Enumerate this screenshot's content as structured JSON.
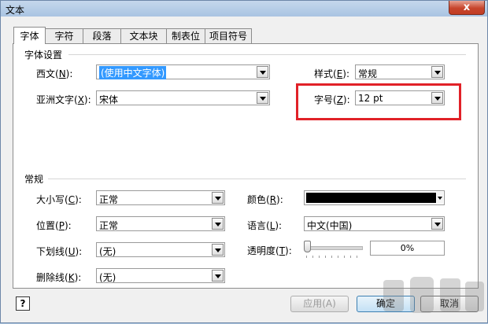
{
  "window": {
    "title": "文本",
    "close_glyph": "x"
  },
  "tabs": [
    "字体",
    "字符",
    "段落",
    "文本块",
    "制表位",
    "项目符号"
  ],
  "font_settings": {
    "group_title": "字体设置",
    "western_label": "西文(",
    "western_key": "N",
    "western_tail": "):",
    "western_value": "(使用中文字体)",
    "asian_label": "亚洲文字(",
    "asian_key": "X",
    "asian_tail": "):",
    "asian_value": "宋体",
    "style_label": "样式(",
    "style_key": "E",
    "style_tail": "):",
    "style_value": "常规",
    "size_label": "字号(",
    "size_key": "Z",
    "size_tail": "):",
    "size_value": "12 pt"
  },
  "general": {
    "group_title": "常规",
    "case_label": "大小写(",
    "case_key": "C",
    "case_tail": "):",
    "case_value": "正常",
    "position_label": "位置(",
    "position_key": "P",
    "position_tail": "):",
    "position_value": "正常",
    "underline_label": "下划线(",
    "underline_key": "U",
    "underline_tail": "):",
    "underline_value": "(无)",
    "strike_label": "删除线(",
    "strike_key": "K",
    "strike_tail": "):",
    "strike_value": "(无)",
    "color_label": "颜色(",
    "color_key": "R",
    "color_tail": "):",
    "color_value": "#000000",
    "language_label": "语言(",
    "language_key": "L",
    "language_tail": "):",
    "language_value": "中文(中国)",
    "transparency_label": "透明度(",
    "transparency_key": "T",
    "transparency_tail": "):",
    "transparency_value": "0%",
    "transparency_fraction": 0
  },
  "footer": {
    "help_glyph": "?",
    "apply_label": "应用(A)",
    "ok_label": "确定",
    "cancel_label": "取消"
  },
  "colors": {
    "highlight": "#e12128",
    "selection": "#3399ff"
  }
}
